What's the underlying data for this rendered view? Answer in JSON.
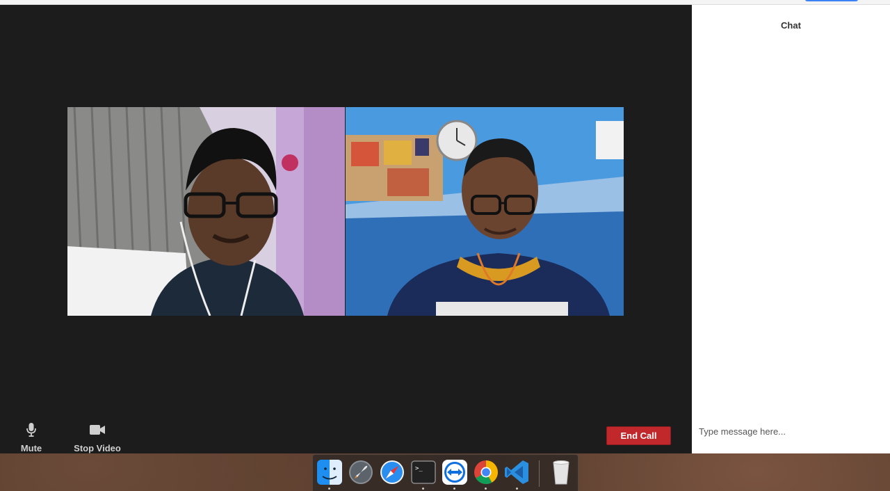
{
  "chat": {
    "title": "Chat",
    "input_placeholder": "Type message here..."
  },
  "controls": {
    "mute_label": "Mute",
    "stop_video_label": "Stop Video",
    "end_call_label": "End Call"
  },
  "videos": [
    {
      "name": "participant-1"
    },
    {
      "name": "participant-2"
    }
  ],
  "dock": {
    "apps": [
      "finder-icon",
      "launchpad-icon",
      "safari-icon",
      "terminal-icon",
      "teamviewer-icon",
      "chrome-icon",
      "vscode-icon",
      "trash-icon"
    ]
  },
  "colors": {
    "end_call": "#c0282b",
    "call_background": "#1c1c1c",
    "chat_background": "#ffffff"
  }
}
